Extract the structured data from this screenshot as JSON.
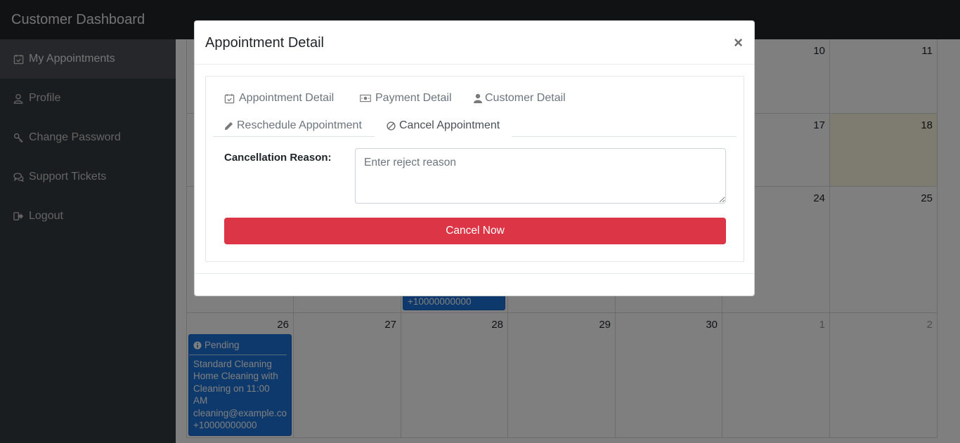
{
  "app": {
    "title": "Customer Dashboard"
  },
  "sidebar": {
    "items": [
      {
        "label": "My Appointments",
        "icon": "calendar-check-icon"
      },
      {
        "label": "Profile",
        "icon": "user-icon"
      },
      {
        "label": "Change Password",
        "icon": "key-icon"
      },
      {
        "label": "Support Tickets",
        "icon": "comments-icon"
      },
      {
        "label": "Logout",
        "icon": "sign-out-icon"
      }
    ]
  },
  "calendar": {
    "visible_numbers": {
      "d10": "10",
      "d11": "11",
      "d17": "17",
      "d18": "18",
      "d24": "24",
      "d25": "25",
      "d26": "26",
      "d27": "27",
      "d28": "28",
      "d29": "29",
      "d30": "30",
      "d1": "1",
      "d2": "2"
    },
    "event_main": {
      "status": "Pending",
      "line1": "Standard Cleaning",
      "line2": "Home Cleaning with",
      "line3": "Cleaning on 11:00",
      "line4": "AM",
      "line5": "cleaning@example.cor",
      "line6": "+10000000000"
    },
    "event_partial": {
      "phone": "+10000000000"
    }
  },
  "modal": {
    "title": "Appointment Detail",
    "close": "×",
    "tabs": [
      {
        "label": "Appointment Detail",
        "icon": "calendar-check-icon"
      },
      {
        "label": "Payment Detail",
        "icon": "money-icon"
      },
      {
        "label": "Customer Detail",
        "icon": "user-icon"
      },
      {
        "label": "Reschedule Appointment",
        "icon": "pencil-icon"
      },
      {
        "label": "Cancel Appointment",
        "icon": "ban-icon"
      }
    ],
    "active_tab": "Cancel Appointment",
    "form": {
      "reason_label": "Cancellation Reason:",
      "reason_placeholder": "Enter reject reason",
      "submit_label": "Cancel Now"
    }
  },
  "colors": {
    "danger": "#dc3545",
    "event_blue": "#1a73d9",
    "today_highlight": "#fcf8e3",
    "sidebar_bg": "#343a40",
    "topbar_bg": "#212529"
  }
}
